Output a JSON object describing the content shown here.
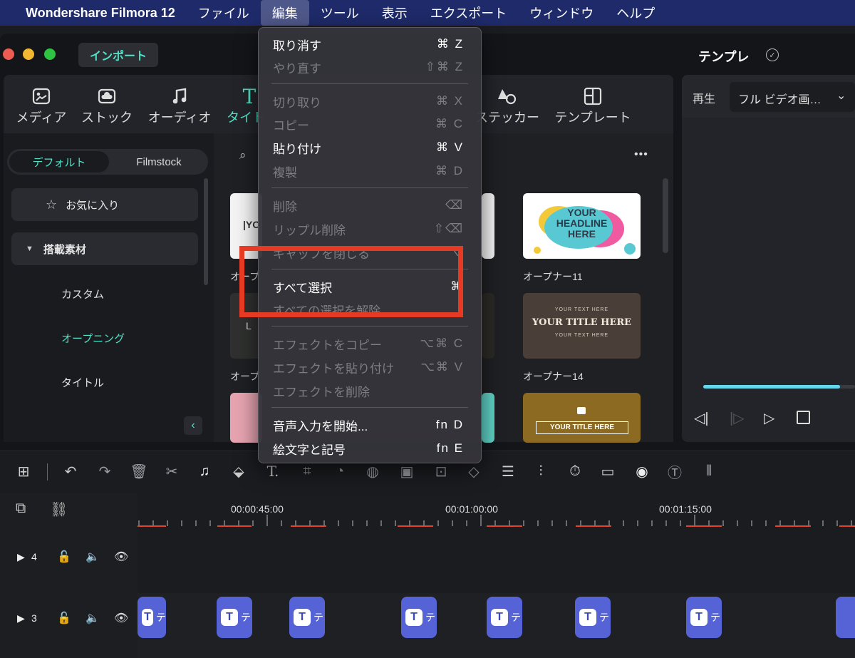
{
  "menubar": {
    "apple": "",
    "app_name": "Wondershare Filmora 12",
    "items": [
      "ファイル",
      "編集",
      "ツール",
      "表示",
      "エクスポート",
      "ウィンドウ",
      "ヘルプ"
    ]
  },
  "window": {
    "import_label": "インポート",
    "template_title": "テンプレ"
  },
  "library_tabs": [
    "メディア",
    "ストック",
    "オーディオ",
    "タイト",
    "ステッカー",
    "テンプレート"
  ],
  "sidebar": {
    "segment_default": "デフォルト",
    "segment_filmstock": "Filmstock",
    "favorites": "お気に入り",
    "builtin": "搭載素材",
    "custom": "カスタム",
    "opening": "オープニング",
    "title": "タイトル"
  },
  "content": {
    "more": "•••",
    "thumb_labels": [
      "オープナー11",
      "オープナー14",
      "オープ",
      "オープ"
    ],
    "thumb_texts": {
      "headline": "YOUR\nHEADLINE\nHERE",
      "title_here": "YOUR TITLE HERE",
      "your_text_here": "YOUR TEXT HERE",
      "title_here_gold": "YOUR TITLE HERE",
      "yo": "|YO",
      "l": "L"
    }
  },
  "preview": {
    "play_label": "再生",
    "quality_select": "フル ビデオ画…",
    "progress": 0.9
  },
  "timeline": {
    "times": [
      "00:00:45:00",
      "00:01:00:00",
      "00:01:15:00"
    ],
    "track4_num": "4",
    "track3_num": "3",
    "clip_letter": "T",
    "clip_text": "テ"
  },
  "edit_menu": {
    "items": [
      {
        "label": "取り消す",
        "shortcut": "⌘ Z",
        "enabled": true
      },
      {
        "label": "やり直す",
        "shortcut": "⇧⌘ Z",
        "enabled": false
      },
      {
        "label": "切り取り",
        "shortcut": "⌘ X",
        "enabled": false
      },
      {
        "label": "コピー",
        "shortcut": "⌘ C",
        "enabled": false
      },
      {
        "label": "貼り付け",
        "shortcut": "⌘ V",
        "enabled": true
      },
      {
        "label": "複製",
        "shortcut": "⌘ D",
        "enabled": false
      },
      {
        "label": "削除",
        "shortcut": "⌫",
        "enabled": false
      },
      {
        "label": "リップル削除",
        "shortcut": "⇧⌫",
        "enabled": false
      },
      {
        "label": "ギャップを閉じる",
        "shortcut": "⌥",
        "enabled": false
      },
      {
        "label": "すべて選択",
        "shortcut": "⌘",
        "enabled": true
      },
      {
        "label": "すべての選択を解除",
        "shortcut": "",
        "enabled": false
      },
      {
        "label": "エフェクトをコピー",
        "shortcut": "⌥⌘ C",
        "enabled": false
      },
      {
        "label": "エフェクトを貼り付け",
        "shortcut": "⌥⌘ V",
        "enabled": false
      },
      {
        "label": "エフェクトを削除",
        "shortcut": "",
        "enabled": false
      },
      {
        "label": "音声入力を開始...",
        "shortcut": "fn D",
        "enabled": true
      },
      {
        "label": "絵文字と記号",
        "shortcut": "fn E",
        "enabled": true
      }
    ]
  },
  "colors": {
    "accent": "#4fe3c8",
    "highlight": "#e63b22",
    "clip": "#5563d6",
    "menubar": "#1e2a6a"
  }
}
